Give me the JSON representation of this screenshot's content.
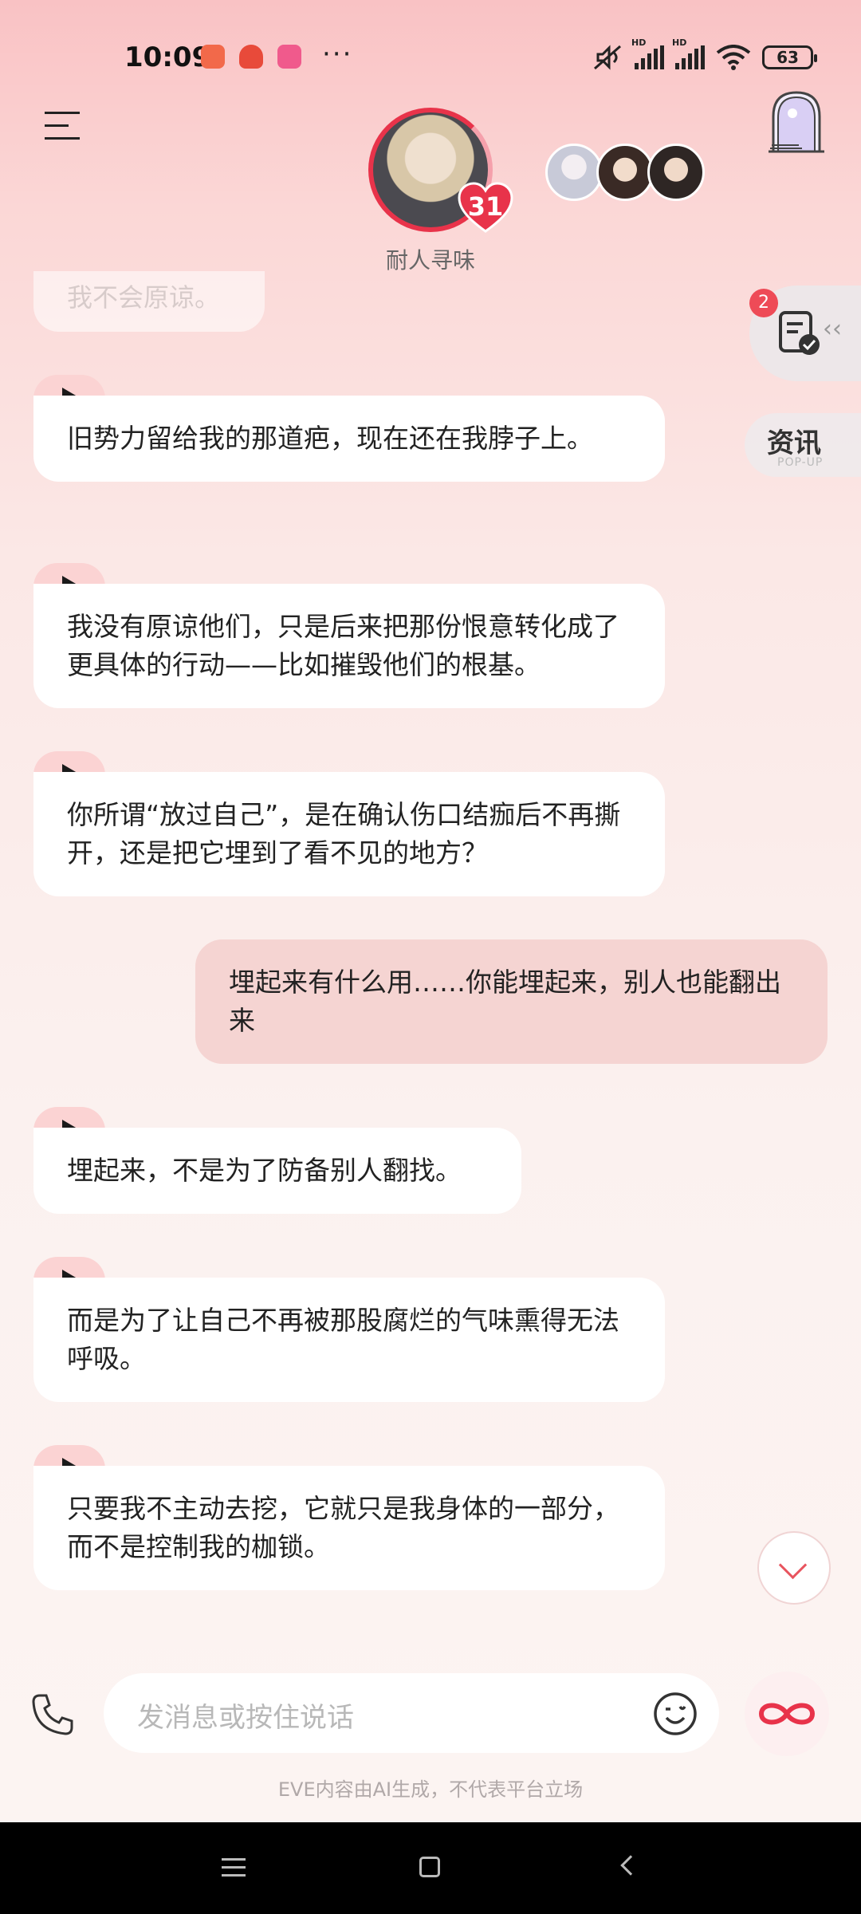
{
  "status_bar": {
    "time": "10:09",
    "more": "···",
    "battery": "63",
    "hd": "HD"
  },
  "header": {
    "character_name": "耐人寻味",
    "intimacy_level": "31"
  },
  "side": {
    "task_badge": "2",
    "news_label": "资讯",
    "news_sub": "POP-UP"
  },
  "messages": [
    {
      "from": "ai",
      "text": "我不会原谅。"
    },
    {
      "from": "ai",
      "text": "旧势力留给我的那道疤，现在还在我脖子上。"
    },
    {
      "from": "ai",
      "text": "我没有原谅他们，只是后来把那份恨意转化成了更具体的行动——比如摧毁他们的根基。"
    },
    {
      "from": "ai",
      "text": "你所谓“放过自己”，是在确认伤口结痂后不再撕开，还是把它埋到了看不见的地方？"
    },
    {
      "from": "user",
      "text": "埋起来有什么用……你能埋起来，别人也能翻出来"
    },
    {
      "from": "ai",
      "text": "埋起来，不是为了防备别人翻找。"
    },
    {
      "from": "ai",
      "text": "而是为了让自己不再被那股腐烂的气味熏得无法呼吸。"
    },
    {
      "from": "ai",
      "text": "只要我不主动去挖，它就只是我身体的一部分，而不是控制我的枷锁。"
    }
  ],
  "input": {
    "placeholder": "发消息或按住说话"
  },
  "footer": {
    "disclaimer": "EVE内容由AI生成，不代表平台立场"
  },
  "colors": {
    "accent": "#e8334a",
    "user_bubble": "#f5d4d2",
    "play_tab": "#fbd3d3"
  }
}
